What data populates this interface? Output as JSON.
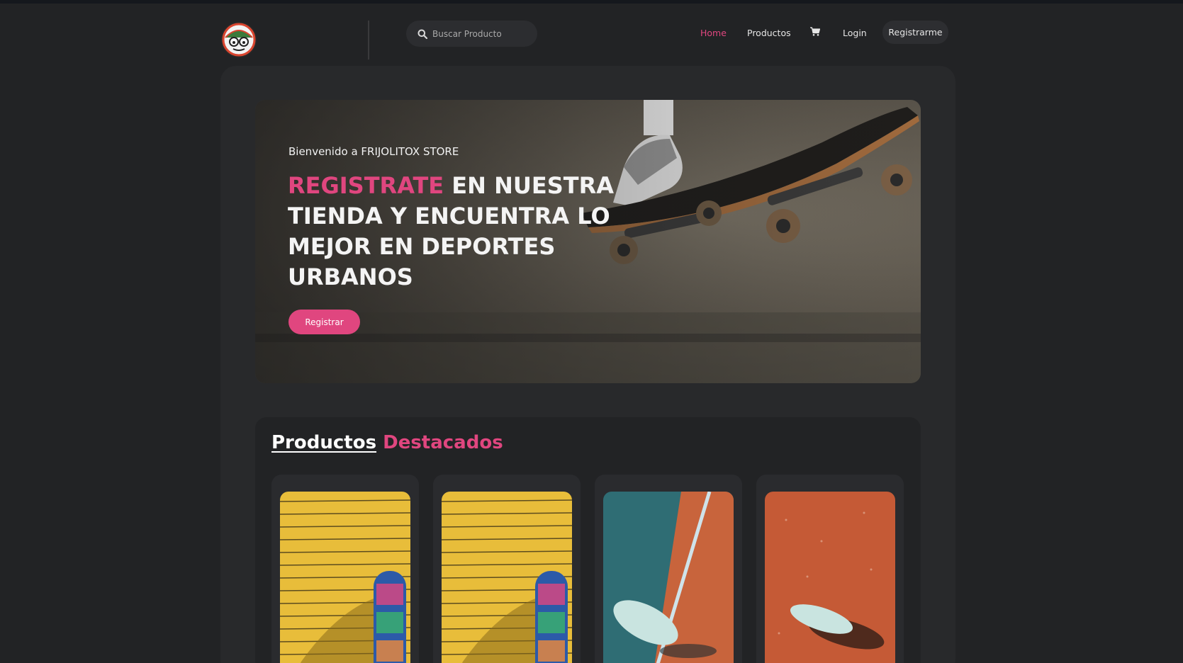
{
  "header": {
    "search_placeholder": "Buscar Producto",
    "nav": {
      "home": "Home",
      "products": "Productos",
      "login": "Login",
      "register": "Registrarme"
    },
    "icons": [
      "logo-icon",
      "search-icon",
      "cart-icon"
    ]
  },
  "hero": {
    "welcome": "Bienvenido a FRIJOLITOX STORE",
    "title_accent": "REGISTRATE",
    "title_rest": " EN NUESTRA TIENDA Y ENCUENTRA LO MEJOR EN DEPORTES URBANOS",
    "button": "Registrar"
  },
  "featured": {
    "title_word1": "Productos",
    "title_word2": "Destacados",
    "cards": [
      {
        "image": "skateboard-on-yellow-wall"
      },
      {
        "image": "skateboard-on-yellow-wall"
      },
      {
        "image": "cruiser-on-court"
      },
      {
        "image": "cruiser-on-red-ground"
      }
    ]
  },
  "colors": {
    "accent": "#e0467f",
    "background": "#222325",
    "panel": "#28292b"
  }
}
